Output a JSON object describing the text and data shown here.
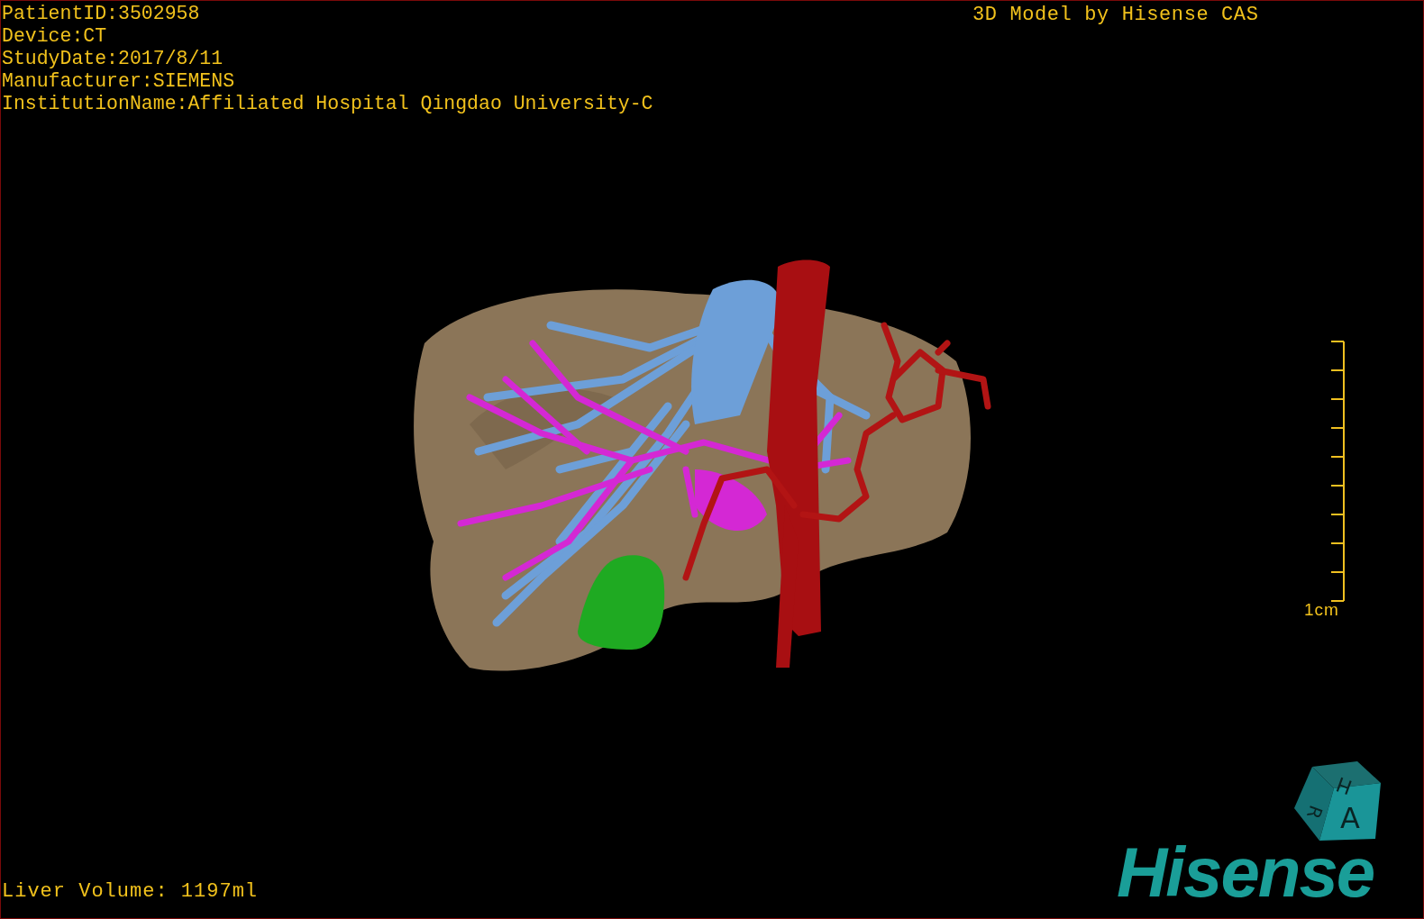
{
  "study_info": [
    "PatientID:3502958",
    "Device:CT",
    "StudyDate:2017/8/11",
    "Manufacturer:SIEMENS",
    "InstitutionName:Affiliated Hospital Qingdao University-C"
  ],
  "title": "3D Model by Hisense CAS",
  "scale_bar": {
    "label": "1cm"
  },
  "liver_volume": "Liver Volume: 1197ml",
  "orientation_cube": {
    "faces": [
      "H",
      "R",
      "A"
    ]
  },
  "logo": "Hisense"
}
